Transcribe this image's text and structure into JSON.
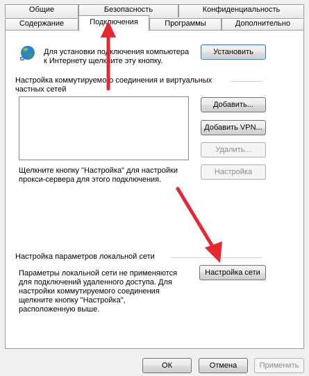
{
  "tabs_top": [
    "Общие",
    "Безопасность",
    "Конфиденциальность"
  ],
  "tabs_bottom": [
    "Содержание",
    "Подключения",
    "Программы",
    "Дополнительно"
  ],
  "setup": {
    "text": [
      "Для установки подключения компьютера",
      "к Интернету щелкните эту кнопку."
    ],
    "button": "Установить",
    "icon": "globe-network-icon"
  },
  "dialup": {
    "section_title": [
      "Настройка коммутируемого соединения и виртуальных",
      "частных сетей"
    ],
    "buttons": {
      "add": "Добавить...",
      "add_vpn": "Добавить VPN...",
      "remove": "Удалить...",
      "settings": "Настройка"
    },
    "note": [
      "Щелкните кнопку \"Настройка\" для настройки",
      "прокси-сервера для этого подключения."
    ]
  },
  "lan": {
    "section_title": "Настройка параметров локальной сети",
    "note": [
      "Параметры локальной сети не применяются",
      "для подключений удаленного доступа. Для",
      "настройки коммутируемого соединения",
      "щелкните кнопку \"Настройка\",",
      "расположенную выше."
    ],
    "button": "Настройка сети"
  },
  "footer": {
    "ok": "ОК",
    "cancel": "Отмена",
    "apply": "Применить"
  },
  "colors": {
    "arrow": "#e8262f",
    "accent_border": "#3c7fb1",
    "panel_border": "#9a9a9a"
  }
}
